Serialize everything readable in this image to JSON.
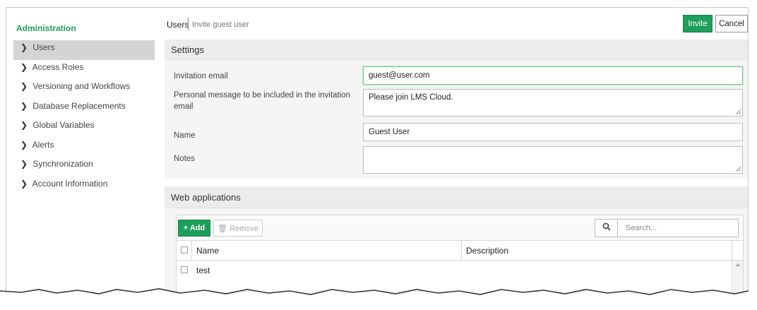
{
  "sidebar": {
    "title": "Administration",
    "items": [
      {
        "label": "Users",
        "active": true
      },
      {
        "label": "Access Roles"
      },
      {
        "label": "Versioning and Workflows"
      },
      {
        "label": "Database Replacements"
      },
      {
        "label": "Global Variables"
      },
      {
        "label": "Alerts"
      },
      {
        "label": "Synchronization"
      },
      {
        "label": "Account Information"
      }
    ]
  },
  "header": {
    "breadcrumb_main": "Users",
    "breadcrumb_sub": "Invite guest user",
    "invite_label": "Invite",
    "cancel_label": "Cancel"
  },
  "settings": {
    "title": "Settings",
    "email_label": "Invitation email",
    "email_value": "guest@user.com",
    "message_label": "Personal message to be included in the invitation email",
    "message_value": "Please join LMS Cloud.",
    "name_label": "Name",
    "name_value": "Guest User",
    "notes_label": "Notes",
    "notes_value": ""
  },
  "web_apps": {
    "title": "Web applications",
    "add_label": "+ Add",
    "remove_label": "Remove",
    "search_placeholder": "Search...",
    "columns": [
      "Name",
      "Description"
    ],
    "rows": [
      {
        "name": "test",
        "description": ""
      }
    ]
  },
  "colors": {
    "accent": "#1e9e5a",
    "active_nav": "#d4d4d4",
    "panel_bg": "#f5f5f5"
  },
  "icons": {
    "nav_chevron": "chevron-right-icon",
    "search": "search-icon",
    "remove": "trash-icon"
  }
}
